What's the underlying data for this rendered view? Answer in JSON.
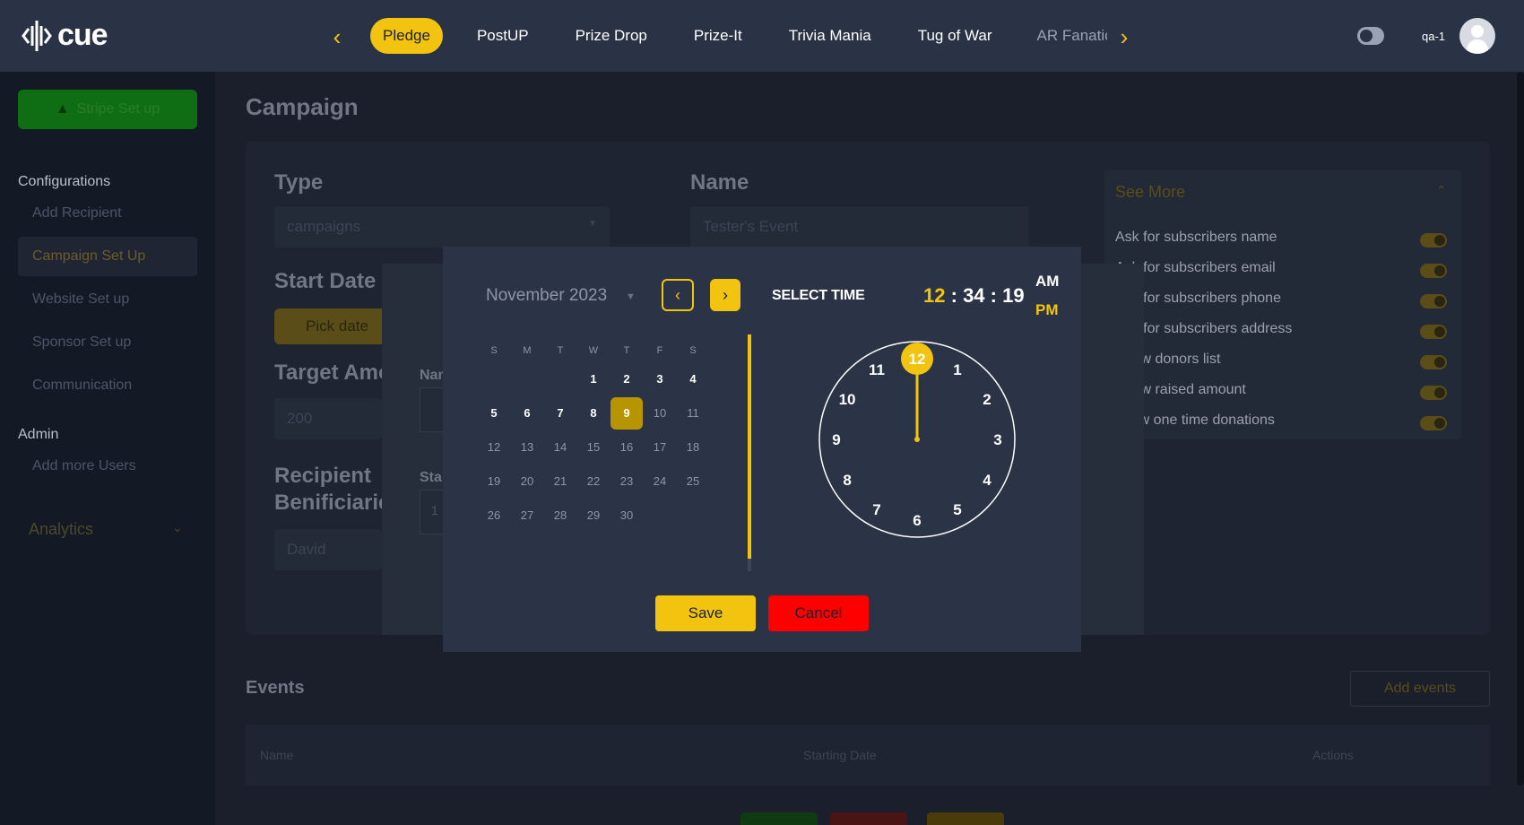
{
  "brand": {
    "name": "cue"
  },
  "nav": {
    "tabs": [
      {
        "label": "Pledge"
      },
      {
        "label": "PostUP"
      },
      {
        "label": "Prize Drop"
      },
      {
        "label": "Prize-It"
      },
      {
        "label": "Trivia Mania"
      },
      {
        "label": "Tug of War"
      },
      {
        "label": "AR Fanatic"
      }
    ],
    "active_tab": "Pledge"
  },
  "user": {
    "name": "qa-1"
  },
  "sidebar": {
    "stripe_button": "Stripe Set up",
    "configurations_label": "Configurations",
    "config_items": [
      "Add Recipient",
      "Campaign Set Up",
      "Website Set up",
      "Sponsor Set up",
      "Communication"
    ],
    "admin_label": "Admin",
    "admin_items": [
      "Add more Users"
    ],
    "analytics_label": "Analytics"
  },
  "page": {
    "title": "Campaign",
    "type_label": "Type",
    "type_value": "campaigns",
    "name_label": "Name",
    "name_value": "Tester's Event",
    "start_date_label": "Start Date",
    "pick_date_button": "Pick date",
    "target_amount_label": "Target Amount",
    "target_amount_value": "200",
    "recipient_label_1": "Recipient",
    "recipient_label_2": "Benificiaries",
    "recipient_value": "David",
    "see_more": {
      "title": "See More",
      "options": [
        "Ask for subscribers name",
        "Ask for subscribers email",
        "Ask for subscribers phone",
        "Ask for subscribers address",
        "Show donors list",
        "Show raised amount",
        "Allow one time donations"
      ]
    },
    "events_title": "Events",
    "add_events_button": "Add events",
    "table_headers": [
      "Name",
      "Starting Date",
      "Actions"
    ],
    "underlying_dialog": {
      "name_label": "Name",
      "start_label": "Start",
      "start_value": "1"
    }
  },
  "picker": {
    "month_label": "November 2023",
    "weekdays": [
      "S",
      "M",
      "T",
      "W",
      "T",
      "F",
      "S"
    ],
    "days": [
      [
        "",
        "",
        "",
        "1",
        "2",
        "3",
        "4"
      ],
      [
        "5",
        "6",
        "7",
        "8",
        "9",
        "10",
        "11"
      ],
      [
        "12",
        "13",
        "14",
        "15",
        "16",
        "17",
        "18"
      ],
      [
        "19",
        "20",
        "21",
        "22",
        "23",
        "24",
        "25"
      ],
      [
        "26",
        "27",
        "28",
        "29",
        "30",
        "",
        ""
      ]
    ],
    "selected_day": "9",
    "select_time_label": "SELECT TIME",
    "time": {
      "hh": "12",
      "mm": "34",
      "ss": "19"
    },
    "am_label": "AM",
    "pm_label": "PM",
    "selected_period": "PM",
    "clock_numbers": [
      "12",
      "1",
      "2",
      "3",
      "4",
      "5",
      "6",
      "7",
      "8",
      "9",
      "10",
      "11"
    ],
    "selected_hour": "12",
    "save_button": "Save",
    "cancel_button": "Cancel"
  },
  "colors": {
    "accent": "#f2c40f",
    "danger": "#ff0000",
    "topbar": "#2a3346",
    "modal": "#2b3446",
    "selected_day": "#b89500"
  }
}
